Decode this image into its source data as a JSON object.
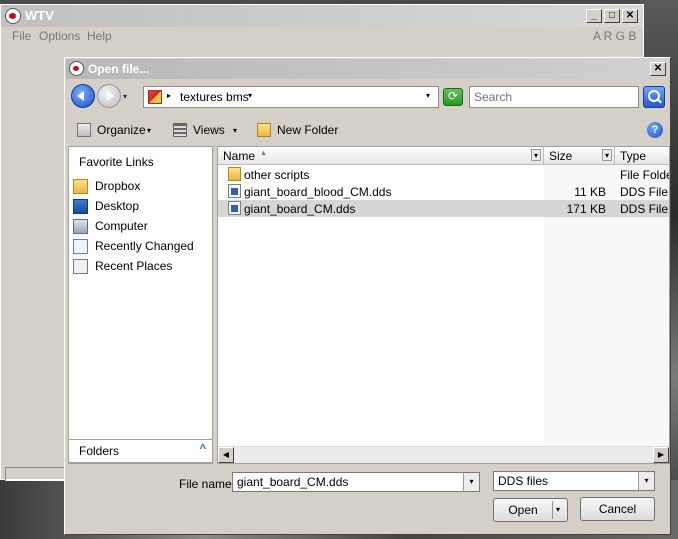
{
  "wtv": {
    "title": "WTV",
    "menu": [
      "File",
      "Options",
      "Help"
    ],
    "channels": "A R G B",
    "buttons": {
      "minimize": "_",
      "maximize": "□",
      "close": "✕"
    }
  },
  "dialog": {
    "title": "Open file...",
    "close_label": "✕",
    "address": {
      "path": "textures bms",
      "chevron": "▸",
      "dropdown": "▾"
    },
    "search": {
      "placeholder": "Search"
    },
    "nav_dropdown": "▾",
    "refresh_glyph": "⟳",
    "toolbar": {
      "organize": "Organize",
      "views": "Views",
      "new_folder": "New Folder",
      "dropdown": "▾",
      "help": "?"
    },
    "sidebar": {
      "header": "Favorite Links",
      "items": [
        {
          "label": "Dropbox",
          "icon": "dropbox-folder-icon"
        },
        {
          "label": "Desktop",
          "icon": "desktop-icon"
        },
        {
          "label": "Computer",
          "icon": "computer-icon"
        },
        {
          "label": "Recently Changed",
          "icon": "recently-changed-icon"
        },
        {
          "label": "Recent Places",
          "icon": "recent-places-icon"
        }
      ],
      "folders_label": "Folders",
      "folders_chevron": "^"
    },
    "columns": {
      "name": "Name",
      "size": "Size",
      "type": "Type",
      "sort_glyph": "▲",
      "dropdown": "▾"
    },
    "files": [
      {
        "name": "other scripts",
        "size": "",
        "type": "File Folder",
        "kind": "folder"
      },
      {
        "name": "giant_board_blood_CM.dds",
        "size": "11 KB",
        "type": "DDS File",
        "kind": "dds"
      },
      {
        "name": "giant_board_CM.dds",
        "size": "171 KB",
        "type": "DDS File",
        "kind": "dds",
        "selected": true
      }
    ],
    "scroll": {
      "left": "◀",
      "right": "▶"
    },
    "file_name": {
      "label": "File name:",
      "value": "giant_board_CM.dds",
      "dropdown": "▾"
    },
    "file_type": {
      "value": "DDS files",
      "dropdown": "▾"
    },
    "open_label": "Open",
    "open_dropdown": "▾",
    "cancel_label": "Cancel"
  }
}
